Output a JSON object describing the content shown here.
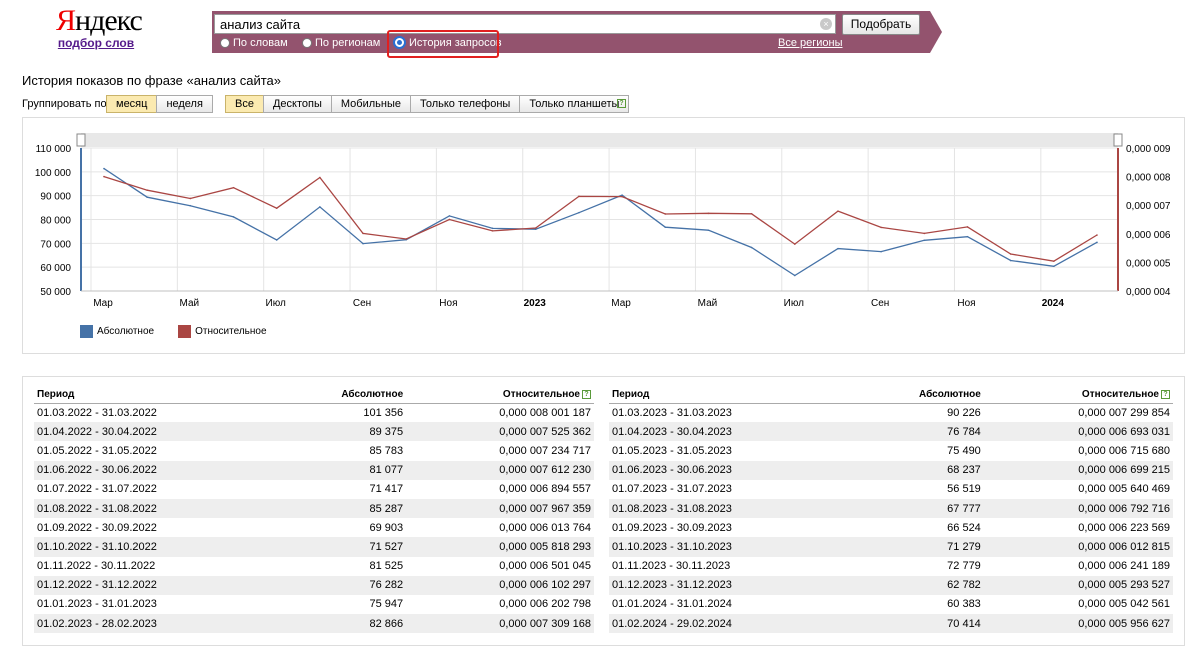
{
  "logo": {
    "first_letter": "Я",
    "rest": "ндекс",
    "subtitle": "подбор слов"
  },
  "search": {
    "value": "анализ сайта",
    "clear_symbol": "×",
    "submit_label": "Подобрать",
    "modes": [
      {
        "label": "По словам",
        "selected": false
      },
      {
        "label": "По регионам",
        "selected": false
      },
      {
        "label": "История запросов",
        "selected": true
      }
    ],
    "regions_link": "Все регионы"
  },
  "page_title": "История показов по фразе «анализ сайта»",
  "grouping": {
    "label": "Группировать по:",
    "options": [
      {
        "label": "месяц",
        "active": true
      },
      {
        "label": "неделя",
        "active": false
      }
    ]
  },
  "devices": {
    "options": [
      {
        "label": "Все",
        "active": true
      },
      {
        "label": "Десктопы",
        "active": false
      },
      {
        "label": "Мобильные",
        "active": false
      },
      {
        "label": "Только телефоны",
        "active": false
      },
      {
        "label": "Только планшеты",
        "active": false
      }
    ],
    "help": "?"
  },
  "chart_data": {
    "type": "line",
    "x": [
      "01.03.2022",
      "01.04.2022",
      "01.05.2022",
      "01.06.2022",
      "01.07.2022",
      "01.08.2022",
      "01.09.2022",
      "01.10.2022",
      "01.11.2022",
      "01.12.2022",
      "01.01.2023",
      "01.02.2023",
      "01.03.2023",
      "01.04.2023",
      "01.05.2023",
      "01.06.2023",
      "01.07.2023",
      "01.08.2023",
      "01.09.2023",
      "01.10.2023",
      "01.11.2023",
      "01.12.2023",
      "01.01.2024",
      "01.02.2024"
    ],
    "x_tick_labels": [
      "Мар",
      "Май",
      "Июл",
      "Сен",
      "Ноя",
      "2023",
      "Мар",
      "Май",
      "Июл",
      "Сен",
      "Ноя",
      "2024"
    ],
    "x_tick_index": [
      0,
      2,
      4,
      6,
      8,
      10,
      12,
      14,
      16,
      18,
      20,
      22
    ],
    "x_tick_bold": [
      false,
      false,
      false,
      false,
      false,
      true,
      false,
      false,
      false,
      false,
      false,
      true
    ],
    "y_left_ticks": [
      "110 000",
      "100 000",
      "90 000",
      "80 000",
      "70 000",
      "60 000",
      "50 000"
    ],
    "y_left_lim": [
      50000,
      110000
    ],
    "y_right_ticks": [
      "0,000 009",
      "0,000 008",
      "0,000 007",
      "0,000 006",
      "0,000 005",
      "0,000 004"
    ],
    "y_right_lim": [
      4e-06,
      9e-06
    ],
    "grid": true,
    "legend_position": "bottom-left",
    "series": [
      {
        "name": "Абсолютное",
        "color": "#4572a7",
        "axis": "left",
        "values": [
          101356,
          89375,
          85783,
          81077,
          71417,
          85287,
          69903,
          71527,
          81525,
          76282,
          75947,
          82866,
          90226,
          76784,
          75490,
          68237,
          56519,
          67777,
          66524,
          71279,
          72779,
          62782,
          60383,
          70414
        ]
      },
      {
        "name": "Относительное",
        "color": "#aa4643",
        "axis": "right",
        "values": [
          8.001187e-06,
          7.525362e-06,
          7.234717e-06,
          7.61223e-06,
          6.894557e-06,
          7.967359e-06,
          6.013764e-06,
          5.818293e-06,
          6.501045e-06,
          6.102297e-06,
          6.202798e-06,
          7.309168e-06,
          7.299854e-06,
          6.693031e-06,
          6.71568e-06,
          6.699215e-06,
          5.640469e-06,
          6.792716e-06,
          6.223569e-06,
          6.012815e-06,
          6.241189e-06,
          5.293527e-06,
          5.042561e-06,
          5.956627e-06
        ]
      }
    ]
  },
  "table": {
    "headers": {
      "period": "Период",
      "absolute": "Абсолютное",
      "relative": "Относительное",
      "help": "?"
    },
    "left": [
      [
        "01.03.2022 - 31.03.2022",
        "101 356",
        "0,000 008 001 187"
      ],
      [
        "01.04.2022 - 30.04.2022",
        "89 375",
        "0,000 007 525 362"
      ],
      [
        "01.05.2022 - 31.05.2022",
        "85 783",
        "0,000 007 234 717"
      ],
      [
        "01.06.2022 - 30.06.2022",
        "81 077",
        "0,000 007 612 230"
      ],
      [
        "01.07.2022 - 31.07.2022",
        "71 417",
        "0,000 006 894 557"
      ],
      [
        "01.08.2022 - 31.08.2022",
        "85 287",
        "0,000 007 967 359"
      ],
      [
        "01.09.2022 - 30.09.2022",
        "69 903",
        "0,000 006 013 764"
      ],
      [
        "01.10.2022 - 31.10.2022",
        "71 527",
        "0,000 005 818 293"
      ],
      [
        "01.11.2022 - 30.11.2022",
        "81 525",
        "0,000 006 501 045"
      ],
      [
        "01.12.2022 - 31.12.2022",
        "76 282",
        "0,000 006 102 297"
      ],
      [
        "01.01.2023 - 31.01.2023",
        "75 947",
        "0,000 006 202 798"
      ],
      [
        "01.02.2023 - 28.02.2023",
        "82 866",
        "0,000 007 309 168"
      ]
    ],
    "right": [
      [
        "01.03.2023 - 31.03.2023",
        "90 226",
        "0,000 007 299 854"
      ],
      [
        "01.04.2023 - 30.04.2023",
        "76 784",
        "0,000 006 693 031"
      ],
      [
        "01.05.2023 - 31.05.2023",
        "75 490",
        "0,000 006 715 680"
      ],
      [
        "01.06.2023 - 30.06.2023",
        "68 237",
        "0,000 006 699 215"
      ],
      [
        "01.07.2023 - 31.07.2023",
        "56 519",
        "0,000 005 640 469"
      ],
      [
        "01.08.2023 - 31.08.2023",
        "67 777",
        "0,000 006 792 716"
      ],
      [
        "01.09.2023 - 30.09.2023",
        "66 524",
        "0,000 006 223 569"
      ],
      [
        "01.10.2023 - 31.10.2023",
        "71 279",
        "0,000 006 012 815"
      ],
      [
        "01.11.2023 - 30.11.2023",
        "72 779",
        "0,000 006 241 189"
      ],
      [
        "01.12.2023 - 31.12.2023",
        "62 782",
        "0,000 005 293 527"
      ],
      [
        "01.01.2024 - 31.01.2024",
        "60 383",
        "0,000 005 042 561"
      ],
      [
        "01.02.2024 - 29.02.2024",
        "70 414",
        "0,000 005 956 627"
      ]
    ]
  }
}
